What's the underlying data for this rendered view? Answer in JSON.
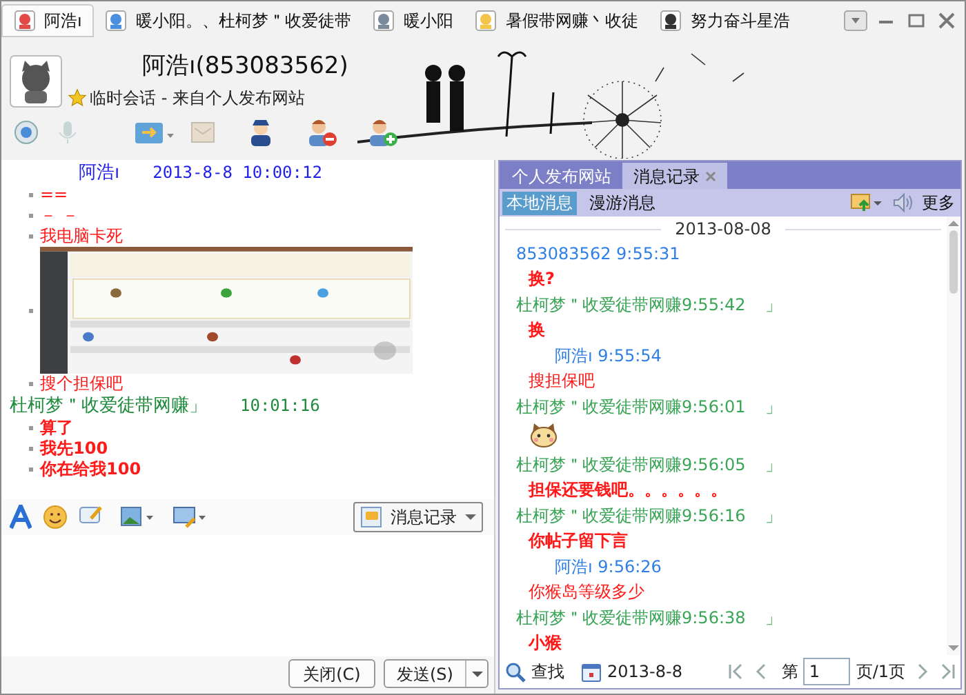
{
  "session_tabs": [
    {
      "label": "阿浩ı",
      "selected": true
    },
    {
      "label": "暖小阳。、杜柯梦＂收爱徒带",
      "selected": false
    },
    {
      "label": "暖小阳",
      "selected": false
    },
    {
      "label": "暑假带网赚丶收徒",
      "selected": false
    },
    {
      "label": "努力奋斗星浩",
      "selected": false
    }
  ],
  "contact": {
    "name": "阿浩ı(853083562)",
    "subtitle": "临时会话 - 来自个人发布网站"
  },
  "chat": [
    {
      "kind": "header",
      "sender": "阿浩ı",
      "time": "2013-8-8 10:00:12",
      "color": "#1f1fe8"
    },
    {
      "kind": "text",
      "text": "==",
      "bold": false
    },
    {
      "kind": "text",
      "text": "－ －",
      "bold": false
    },
    {
      "kind": "text",
      "text": "我电脑卡死",
      "bold": false
    },
    {
      "kind": "picture"
    },
    {
      "kind": "text",
      "text": "搜个担保吧",
      "bold": false
    },
    {
      "kind": "header",
      "sender": "杜柯梦＂收爱徒带网赚」",
      "time": "10:01:16",
      "color": "#1e8a3c"
    },
    {
      "kind": "text",
      "text": "算了",
      "bold": true
    },
    {
      "kind": "text",
      "text": "我先100",
      "bold": true
    },
    {
      "kind": "text",
      "text": "你在给我100",
      "bold": true
    }
  ],
  "history_button": "消息记录",
  "close_button": "关闭(C)",
  "send_button": "发送(S)",
  "side_panel": {
    "tabs": [
      {
        "label": "个人发布网站",
        "selected": false
      },
      {
        "label": "消息记录",
        "selected": true
      }
    ],
    "subtabs": [
      {
        "label": "本地消息",
        "selected": true
      },
      {
        "label": "漫游消息",
        "selected": false
      }
    ],
    "more": "更多",
    "date": "2013-08-08",
    "messages": [
      {
        "kind": "header",
        "text": "853083562 9:55:31",
        "color": "#2f7fe6",
        "indented": false
      },
      {
        "kind": "text",
        "text": "换?",
        "bold": true
      },
      {
        "kind": "header",
        "text": "杜柯梦＂收爱徒带网赚9:55:42",
        "suffix": "」",
        "color": "#3aa556",
        "indented": false
      },
      {
        "kind": "text",
        "text": "换",
        "bold": true
      },
      {
        "kind": "header",
        "text": "阿浩ı 9:55:54",
        "color": "#2f7fe6",
        "indented": true
      },
      {
        "kind": "text",
        "text": "搜担保吧",
        "bold": false
      },
      {
        "kind": "header",
        "text": "杜柯梦＂收爱徒带网赚9:56:01",
        "suffix": "」",
        "color": "#3aa556",
        "indented": false
      },
      {
        "kind": "emoji"
      },
      {
        "kind": "header",
        "text": "杜柯梦＂收爱徒带网赚9:56:05",
        "suffix": "」",
        "color": "#3aa556",
        "indented": false
      },
      {
        "kind": "text",
        "text": "担保还要钱吧。。。。。。",
        "bold": true
      },
      {
        "kind": "header",
        "text": "杜柯梦＂收爱徒带网赚9:56:16",
        "suffix": "」",
        "color": "#3aa556",
        "indented": false
      },
      {
        "kind": "text",
        "text": "你帖子留下言",
        "bold": true
      },
      {
        "kind": "header",
        "text": "阿浩ı 9:56:26",
        "color": "#2f7fe6",
        "indented": true
      },
      {
        "kind": "text",
        "text": "你猴岛等级多少",
        "bold": false
      },
      {
        "kind": "header",
        "text": "杜柯梦＂收爱徒带网赚9:56:38",
        "suffix": "」",
        "color": "#3aa556",
        "indented": false
      },
      {
        "kind": "text",
        "text": "小猴",
        "bold": true
      }
    ],
    "search": "查找",
    "date_filter": "2013-8-8",
    "page_prefix": "第",
    "page": "1",
    "page_suffix": "页/1页"
  }
}
